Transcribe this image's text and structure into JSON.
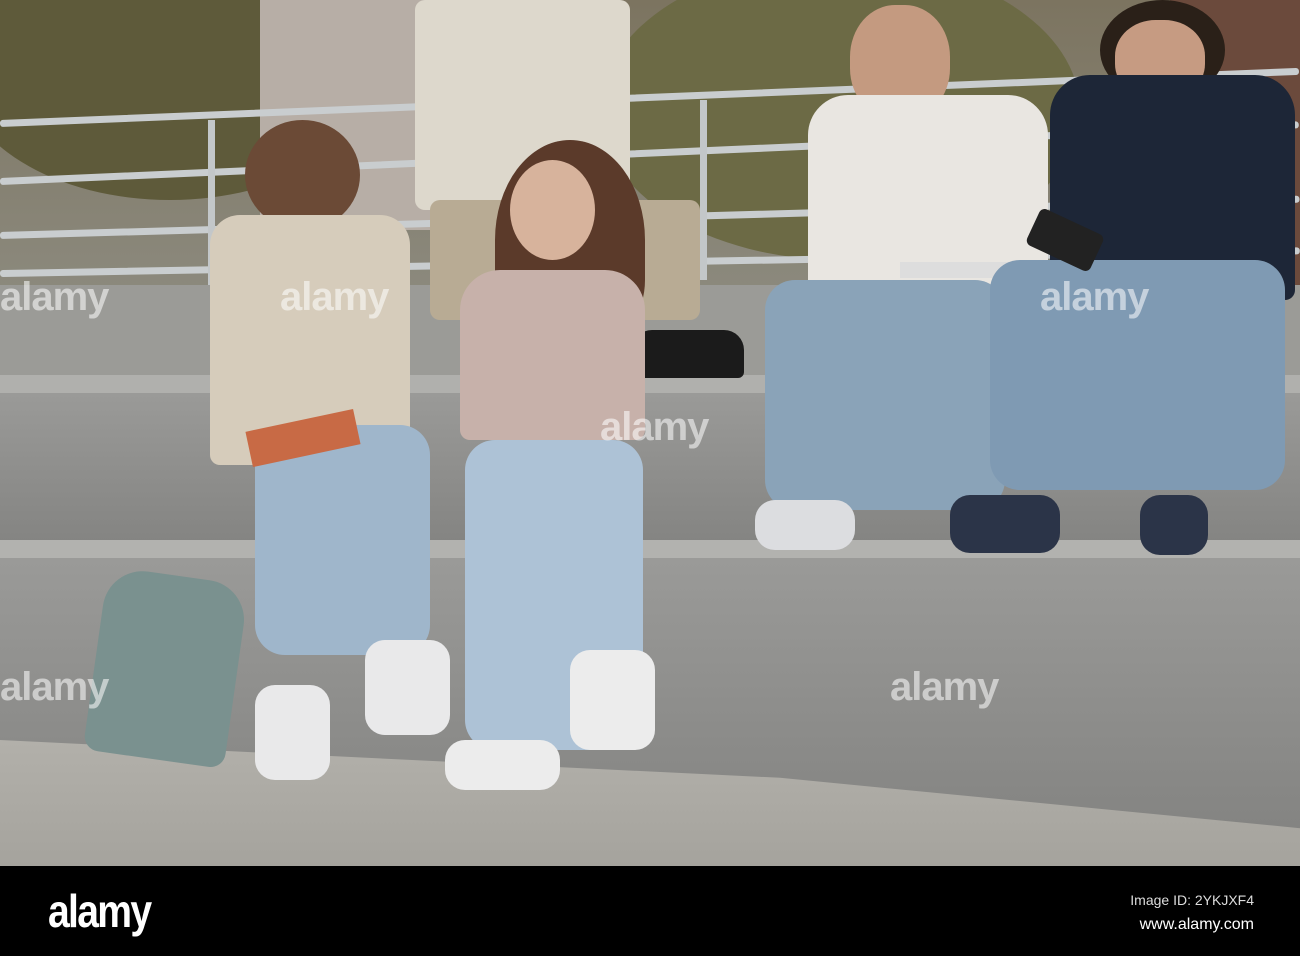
{
  "photo": {
    "subject": "students-on-steps",
    "watermark_text": "alamy"
  },
  "footer": {
    "logo": "alamy",
    "image_id": "Image ID: 2YKJXF4",
    "website": "www.alamy.com"
  },
  "colors": {
    "footer_bg": "#000000",
    "stone": "#8f8f8d",
    "denim": "#8ea6bd"
  }
}
